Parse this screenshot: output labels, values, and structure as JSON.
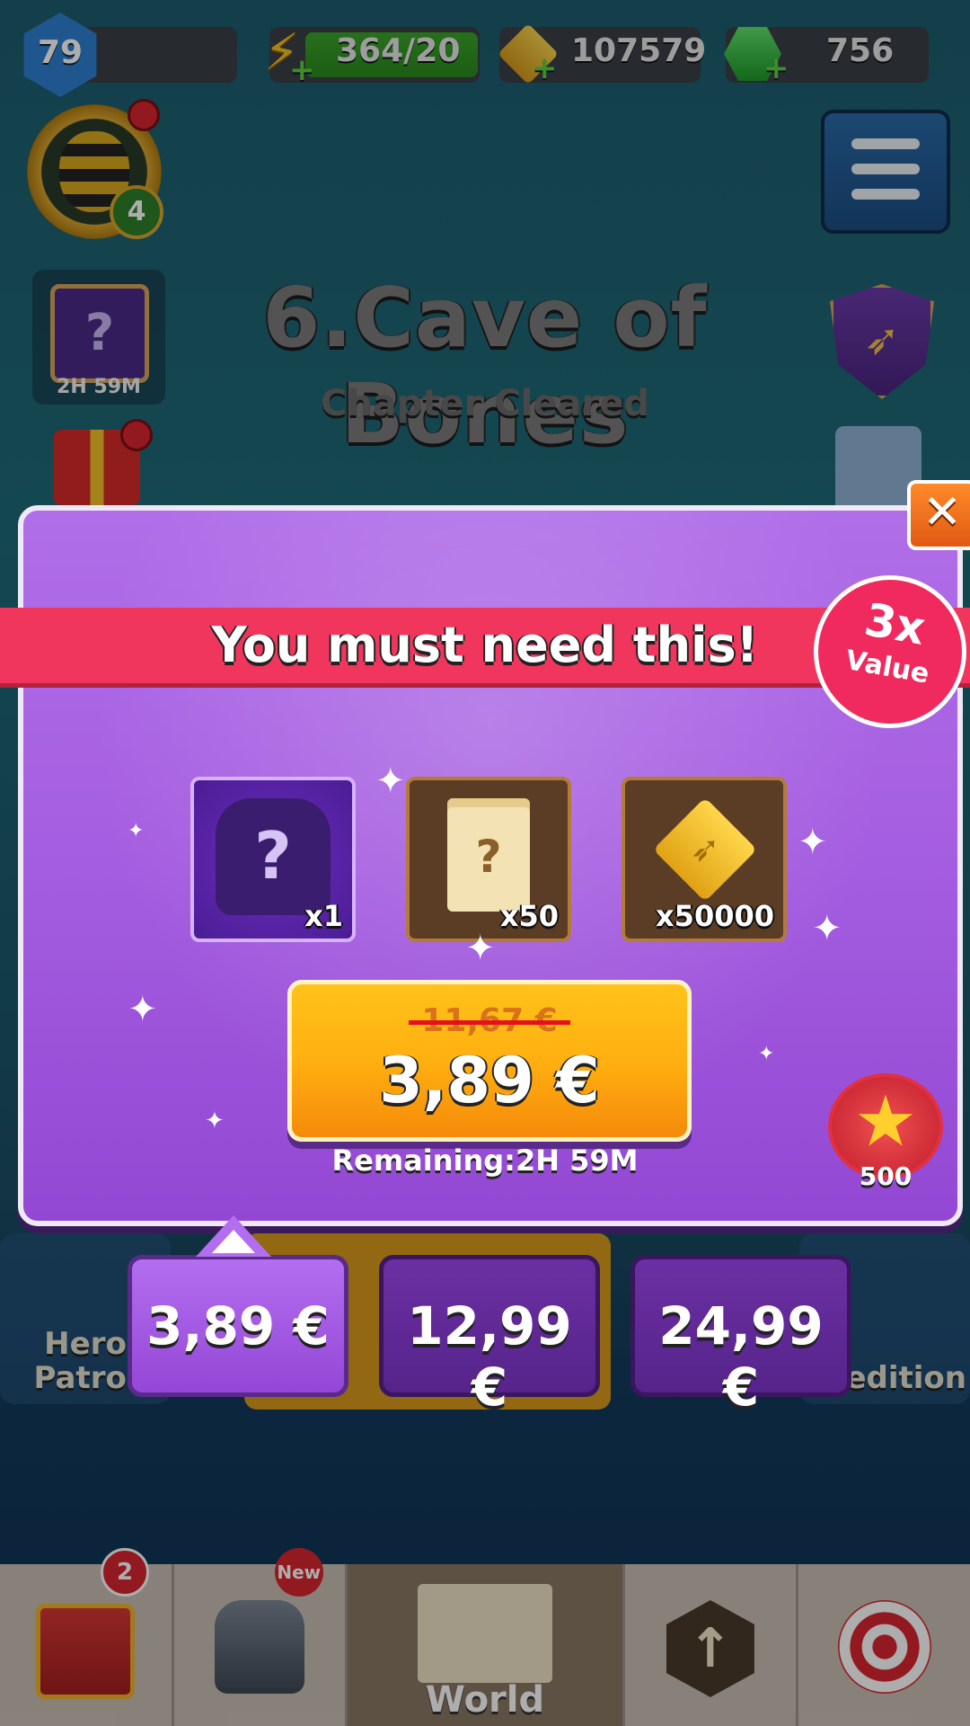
{
  "topbar": {
    "level": "79",
    "energy": "364/20",
    "arrows": "107579",
    "gems": "756"
  },
  "avatar": {
    "level": "4"
  },
  "side": {
    "mystery_timer": "2H 59M"
  },
  "chapter": {
    "title": "6.Cave of Bones",
    "subtitle": "Chapter Cleared"
  },
  "modes": {
    "left_label_line1": "Hero",
    "left_label_line2": "Patrol",
    "right_label": "xpedition"
  },
  "popup": {
    "close_symbol": "✕",
    "banner": "You must need this!",
    "value_badge": {
      "multiplier": "3x",
      "label": "Value"
    },
    "items": [
      {
        "icon": "mystery-armor-icon",
        "qty": "x1"
      },
      {
        "icon": "mystery-scroll-icon",
        "qty": "x50"
      },
      {
        "icon": "bow-token-icon",
        "qty": "x50000"
      }
    ],
    "old_price": "11,67 €",
    "new_price": "3,89 €",
    "remaining": "Remaining:2H 59M",
    "bonus_count": "500"
  },
  "price_tabs": [
    {
      "label": "3,89 €",
      "selected": true
    },
    {
      "label": "12,99 €",
      "selected": false
    },
    {
      "label": "24,99 €",
      "selected": false
    }
  ],
  "bottom_nav": {
    "chest_badge": "2",
    "armor_badge": "New",
    "world_label": "World"
  },
  "colors": {
    "popup": "#a45de0",
    "ribbon": "#f0365c",
    "buy_button": "#ffb010"
  }
}
